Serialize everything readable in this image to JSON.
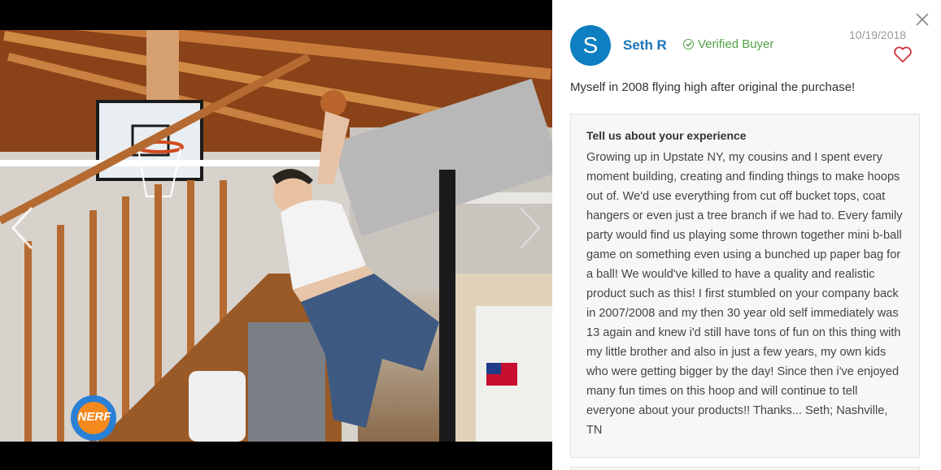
{
  "media": {
    "photo_label": "nerf-basement-dunk-photo",
    "badge_text": "NERF",
    "prev_icon": "chevron-left-icon",
    "next_icon": "chevron-right-icon"
  },
  "review": {
    "avatar_letter": "S",
    "reviewer_name": "Seth R",
    "verified_label": "Verified Buyer",
    "date": "10/19/2018",
    "title": "Myself in 2008 flying high after original the purchase!",
    "question_label": "Tell us about your experience",
    "answer": "Growing up in Upstate NY, my cousins and I spent every moment building, creating and finding things to make hoops out of. We'd use everything from cut off bucket tops, coat hangers or even just a tree branch if we had to. Every family party would find us playing some thrown together mini b-ball game on something even using a bunched up paper bag for a ball! We would've killed to have a quality and realistic product such as this! I first stumbled on your company back in 2007/2008 and my then 30 year old self immediately was 13 again and knew i'd still have tons of fun on this thing with my little brother and also in just a few years, my own kids who were getting bigger by the day! Since then i've enjoyed many fun times on this hoop and will continue to tell everyone about your products!! Thanks... Seth; Nashville, TN"
  },
  "colors": {
    "accent_blue": "#1b74b8",
    "avatar_blue": "#0e7fc0",
    "verified_green": "#53a046",
    "heart_red": "#d0343a"
  }
}
